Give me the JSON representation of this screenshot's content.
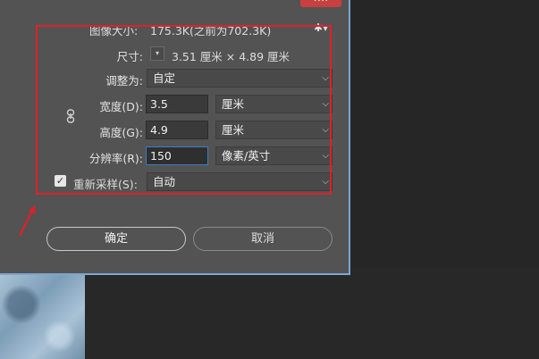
{
  "dialog": {
    "image_size_label": "图像大小:",
    "image_size_value": "175.3K(之前为702.3K)",
    "close_glyph": "✕✕",
    "gear_glyph": "✱▾"
  },
  "dimensions": {
    "label": "尺寸:",
    "value": "3.51 厘米 × 4.89 厘米",
    "dropdown_glyph": "▾"
  },
  "fit_to": {
    "label": "调整为:",
    "value": "自定"
  },
  "width": {
    "label": "宽度(D):",
    "value": "3.5",
    "unit": "厘米"
  },
  "height": {
    "label": "高度(G):",
    "value": "4.9",
    "unit": "厘米"
  },
  "resolution": {
    "label": "分辨率(R):",
    "value": "150",
    "unit": "像素/英寸"
  },
  "resample": {
    "label": "重新采样(S):",
    "value": "自动",
    "checked": true,
    "check_glyph": "✓"
  },
  "chevron": "⌵",
  "buttons": {
    "ok": "确定",
    "cancel": "取消"
  },
  "colors": {
    "dialog_bg": "#535353",
    "highlight_box": "#e0202a",
    "focus": "#3d7cc9"
  }
}
